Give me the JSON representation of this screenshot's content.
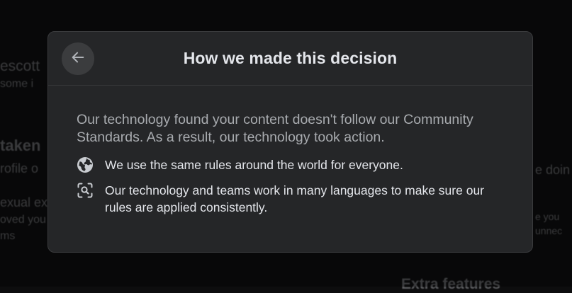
{
  "background": {
    "fragments": [
      "escott",
      "some i",
      "taken",
      "rofile o",
      "exual ex",
      "oved you",
      "ms",
      "e doin",
      "e you",
      "unnec",
      "Extra features"
    ]
  },
  "modal": {
    "back_icon": "arrow-left-icon",
    "title": "How we made this decision",
    "lead": "Our technology found your content doesn't follow our Community Standards. As a result, our technology took action.",
    "items": [
      {
        "icon": "globe-icon",
        "text": "We use the same rules around the world for everyone."
      },
      {
        "icon": "scan-search-icon",
        "text": "Our technology and teams work in many languages to make sure our rules are applied consistently."
      }
    ]
  },
  "colors": {
    "modal_bg": "#252628",
    "title": "#e4e6eb",
    "lead": "#a8abaf"
  }
}
